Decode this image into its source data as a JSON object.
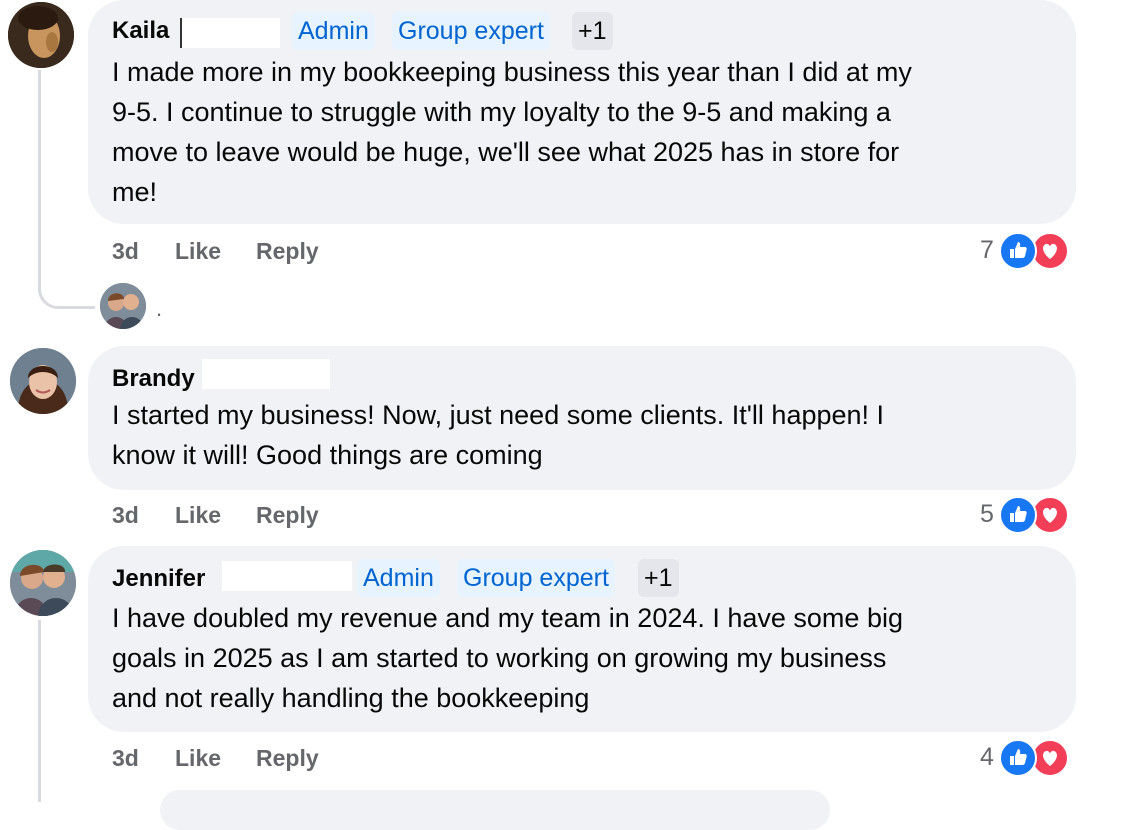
{
  "comments": [
    {
      "author": "Kaila",
      "badges": [
        "Admin",
        "Group expert",
        "+1"
      ],
      "lines": [
        "I made more in my bookkeeping business this year than I did at my",
        "9-5. I continue to struggle with my loyalty to the 9-5 and making a",
        "move to leave would be huge, we'll see what 2025 has in store for",
        "me!"
      ],
      "time": "3d",
      "like": "Like",
      "reply": "Reply",
      "reaction_count": "7"
    },
    {
      "author": "Brandy",
      "badges": [],
      "lines": [
        "I started my business! Now, just need some clients. It'll happen! I",
        "know it will! Good things are coming"
      ],
      "time": "3d",
      "like": "Like",
      "reply": "Reply",
      "reaction_count": "5"
    },
    {
      "author": "Jennifer",
      "badges": [
        "Admin",
        "Group expert",
        "+1"
      ],
      "lines": [
        "I have doubled my revenue and my team in 2024. I have some big",
        "goals in 2025 as I am started to working on growing my business",
        "and not really handling the bookkeeping"
      ],
      "time": "3d",
      "like": "Like",
      "reply": "Reply",
      "reaction_count": "4"
    }
  ],
  "reply_preview": {
    "indicator": "."
  },
  "colors": {
    "like_blue": "#1877f2",
    "love_red": "#f33e58",
    "badge_blue": "#0064d1",
    "bubble": "#f0f2f5",
    "meta_grey": "#65676b"
  }
}
